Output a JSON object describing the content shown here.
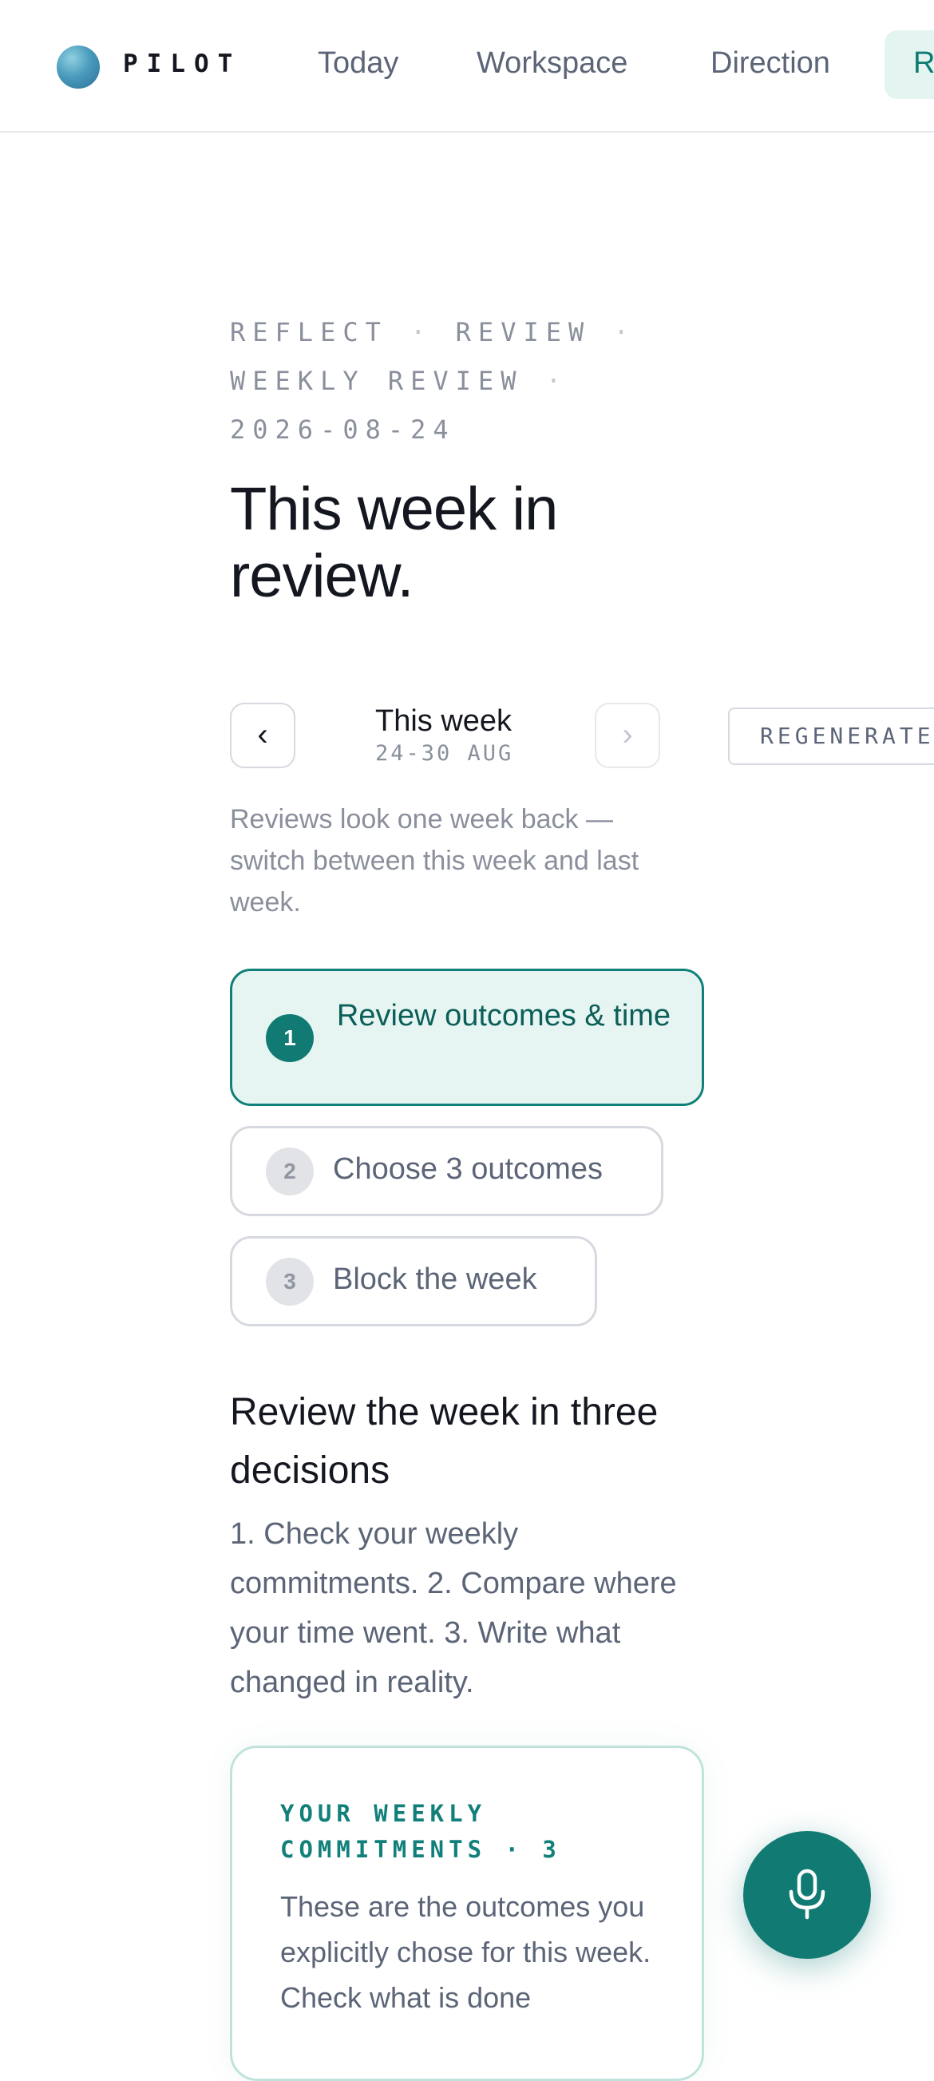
{
  "nav": {
    "brand": "PILOT",
    "items": [
      {
        "label": "Today"
      },
      {
        "label": "Workspace"
      },
      {
        "label": "Direction"
      },
      {
        "label": "R",
        "active": true
      }
    ]
  },
  "header": {
    "breadcrumb": [
      "REFLECT",
      "REVIEW",
      "WEEKLY REVIEW",
      "2026-08-24"
    ],
    "breadcrumb_separator": "·",
    "title": "This week in review."
  },
  "week_selector": {
    "prev_icon": "chevron-left-icon",
    "prev_glyph": "‹",
    "next_icon": "chevron-right-icon",
    "next_glyph": "›",
    "next_enabled": false,
    "label": "This week",
    "range": "24-30 AUG",
    "regenerate_label": "REGENERATE",
    "note": "Reviews look one week back — switch between this week and last week."
  },
  "steps": [
    {
      "number": "1",
      "label": "Review outcomes & time",
      "active": true
    },
    {
      "number": "2",
      "label": "Choose 3 outcomes",
      "active": false
    },
    {
      "number": "3",
      "label": "Block the week",
      "active": false
    }
  ],
  "review": {
    "title": "Review the week in three decisions",
    "body": "1. Check your weekly commitments. 2. Compare where your time went. 3. Write what changed in reality."
  },
  "commitments_card": {
    "heading": "YOUR WEEKLY COMMITMENTS · 3",
    "text": "These are the outcomes you explicitly chose for this week. Check what is done"
  },
  "mic_button": {
    "icon": "microphone-icon"
  },
  "colors": {
    "accent": "#117a73",
    "accent_light": "#e6f5f2",
    "muted_text": "#8a8f9c",
    "body_text": "#5c6577"
  }
}
